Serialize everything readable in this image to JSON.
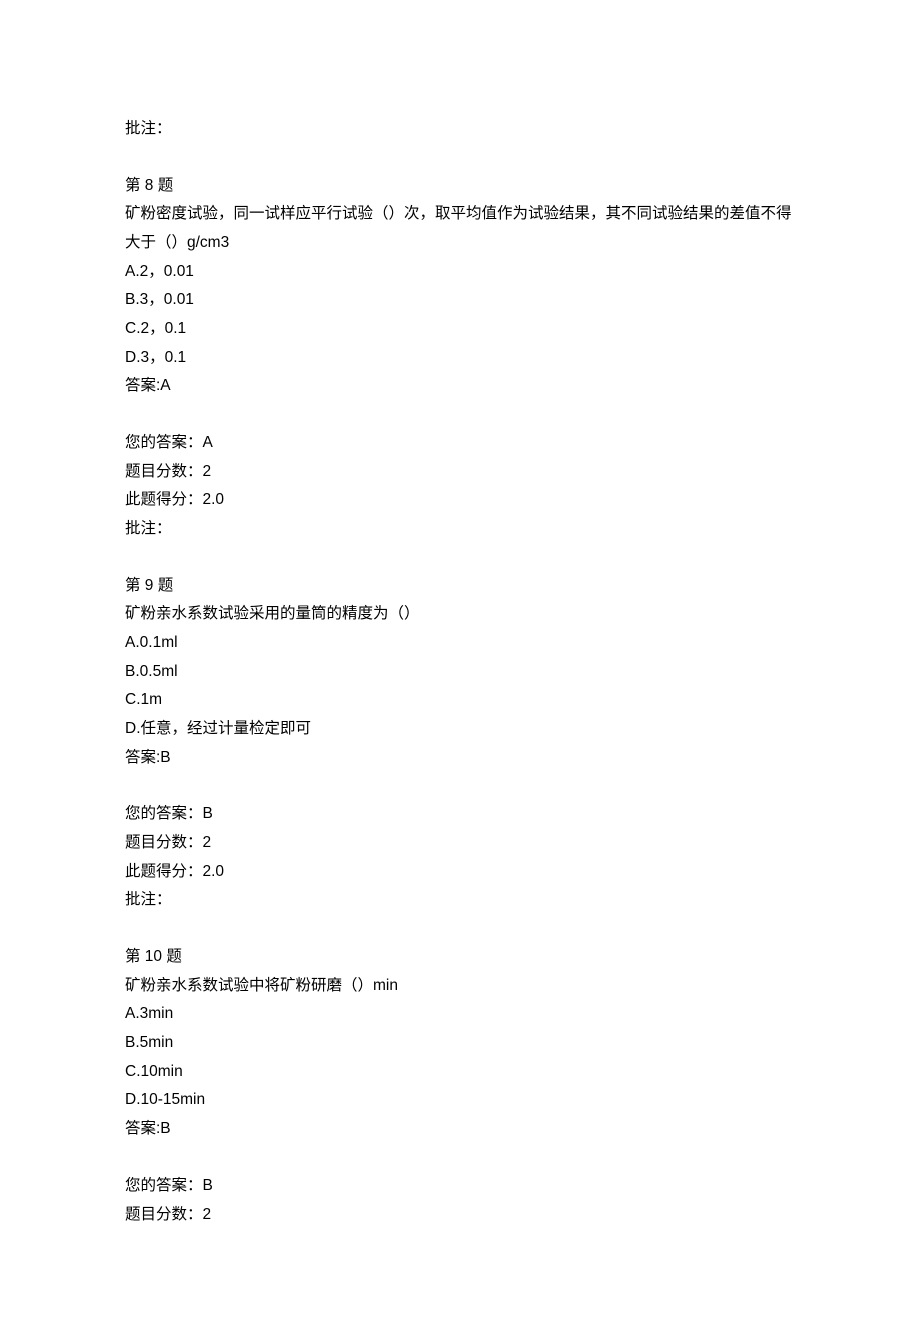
{
  "prev_marginal": {
    "comment_label": "批注："
  },
  "q8": {
    "title": "第 8 题",
    "stem": "矿粉密度试验，同一试样应平行试验（）次，取平均值作为试验结果，其不同试验结果的差值不得大于（）g/cm3",
    "options": {
      "A": "A.2，0.01",
      "B": "B.3，0.01",
      "C": "C.2，0.1",
      "D": "D.3，0.1"
    },
    "answer_line": "答案:A",
    "your_answer_line": "您的答案：A",
    "score_total_line": "题目分数：2",
    "score_got_line": "此题得分：2.0",
    "comment_label": "批注："
  },
  "q9": {
    "title": "第 9 题",
    "stem": "矿粉亲水系数试验采用的量筒的精度为（）",
    "options": {
      "A": "A.0.1ml",
      "B": "B.0.5ml",
      "C": "C.1m",
      "D": "D.任意，经过计量检定即可"
    },
    "answer_line": "答案:B",
    "your_answer_line": "您的答案：B",
    "score_total_line": "题目分数：2",
    "score_got_line": "此题得分：2.0",
    "comment_label": "批注："
  },
  "q10": {
    "title": "第 10 题",
    "stem": "矿粉亲水系数试验中将矿粉研磨（）min",
    "options": {
      "A": "A.3min",
      "B": "B.5min",
      "C": "C.10min",
      "D": "D.10-15min"
    },
    "answer_line": "答案:B",
    "your_answer_line": "您的答案：B",
    "score_total_line": "题目分数：2"
  }
}
